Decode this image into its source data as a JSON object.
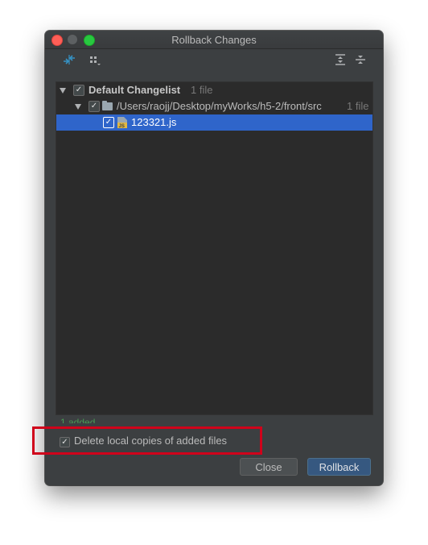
{
  "window": {
    "title": "Rollback Changes"
  },
  "toolbar": {
    "left_icons": [
      "move-changes-icon",
      "group-by-icon"
    ],
    "right_icons": [
      "expand-all-icon",
      "collapse-all-icon"
    ]
  },
  "tree": {
    "changelist": {
      "label": "Default Changelist",
      "count": "1 file",
      "checked": true
    },
    "folder": {
      "label": "/Users/raojj/Desktop/myWorks/h5-2/front/src",
      "count": "1 file",
      "checked": true
    },
    "file": {
      "label": "123321.js",
      "checked": true,
      "selected": true,
      "icon": "javascript-file-icon"
    }
  },
  "summary": "1 added",
  "options": {
    "delete_local_copies": {
      "label": "Delete local copies of added files",
      "checked": true
    }
  },
  "buttons": {
    "close": "Close",
    "rollback": "Rollback"
  },
  "colors": {
    "selection": "#2f65ca",
    "highlight_annotation": "#d0021b",
    "primary_button": "#365880"
  }
}
